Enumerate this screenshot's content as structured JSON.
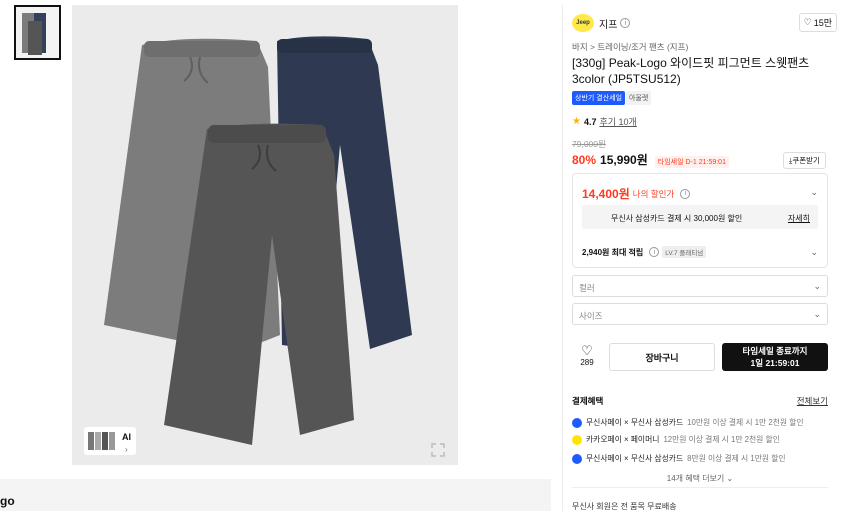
{
  "thumbnails": [
    "product-thumbnail"
  ],
  "gallery": {
    "ai_label": "AI",
    "ai_chevron": "›"
  },
  "bottom_text": "go",
  "brand": {
    "logo_text": "Jeep",
    "name": "지프",
    "like_count": "15만"
  },
  "breadcrumb": "바지 > 트레이닝/조거 팬츠 (지프)",
  "title": "[330g] Peak-Logo 와이드핏 피그먼트 스웻팬츠 3color (JP5TSU512)",
  "badges": [
    "상반기 결산세일",
    "아울렛"
  ],
  "rating": {
    "score": "4.7",
    "reviews": "후기 10개"
  },
  "price": {
    "original": "79,000원",
    "discount": "80%",
    "sale": "15,990원",
    "timesale": "타임세일 D-1 21:59:01",
    "coupon": "쿠폰받기"
  },
  "my_price": {
    "amount": "14,400원",
    "label": "나의 할인가",
    "card_text": "무신사 삼성카드 결제 시 30,000원 할인",
    "card_detail": "자세히",
    "points": "2,940원 최대 적립",
    "level": "LV.7 플래티넘"
  },
  "options": {
    "color": "컬러",
    "size": "사이즈"
  },
  "actions": {
    "like_count": "289",
    "cart": "장바구니",
    "buy_line1": "타임세일 종료까지",
    "buy_line2": "1일 21:59:01"
  },
  "benefits": {
    "title": "결제혜택",
    "all": "전체보기",
    "items": [
      {
        "main": "무신사페이 × 무신사 삼성카드",
        "sub": "10만원 이상 결제 시 1만 2천원 할인",
        "color": "#1e5bff"
      },
      {
        "main": "카카오페이 × 페이머니",
        "sub": "12만원 이상 결제 시 1만 2천원 할인",
        "color": "#ffe500"
      },
      {
        "main": "무신사페이 × 무신사 삼성카드",
        "sub": "8만원 이상 결제 시 1만원 할인",
        "color": "#1e5bff"
      }
    ],
    "more": "14개 혜택 더보기"
  },
  "footer": "무신사 회원은 전 품목 무료배송"
}
